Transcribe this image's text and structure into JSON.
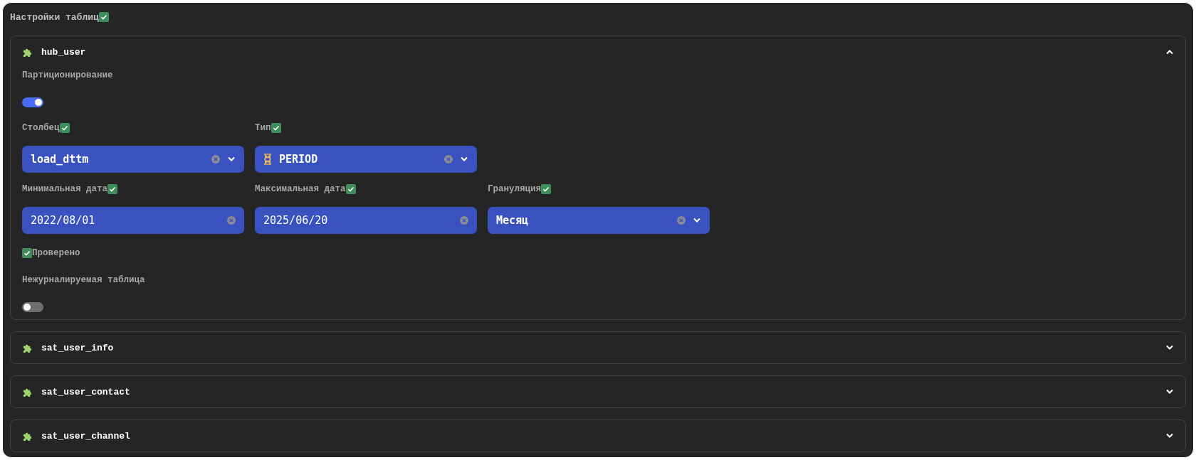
{
  "title": {
    "text": "Настройки таблиц",
    "verified": true
  },
  "tables": [
    {
      "name": "hub_user",
      "expanded": true,
      "partitioning": {
        "label": "Партиционирование",
        "on": true
      },
      "fields": [
        {
          "label": "Столбец",
          "verified": true,
          "value": "load_dttm",
          "kind": "select",
          "icon": false
        },
        {
          "label": "Тип",
          "verified": true,
          "value": "PERIOD",
          "kind": "select",
          "icon": true
        },
        {
          "label": "Минимальная дата",
          "verified": true,
          "value": "2022/08/01",
          "kind": "date",
          "icon": false
        },
        {
          "label": "Максимальная дата",
          "verified": true,
          "value": "2025/06/20",
          "kind": "date",
          "icon": false
        },
        {
          "label": "Грануляция",
          "verified": true,
          "value": "Месяц",
          "kind": "select",
          "icon": false
        }
      ],
      "status": {
        "text": "Проверено",
        "verified": true
      },
      "unlogged": {
        "label": "Нежурналируемая таблица",
        "on": false
      }
    },
    {
      "name": "sat_user_info",
      "expanded": false
    },
    {
      "name": "sat_user_contact",
      "expanded": false
    },
    {
      "name": "sat_user_channel",
      "expanded": false
    }
  ]
}
